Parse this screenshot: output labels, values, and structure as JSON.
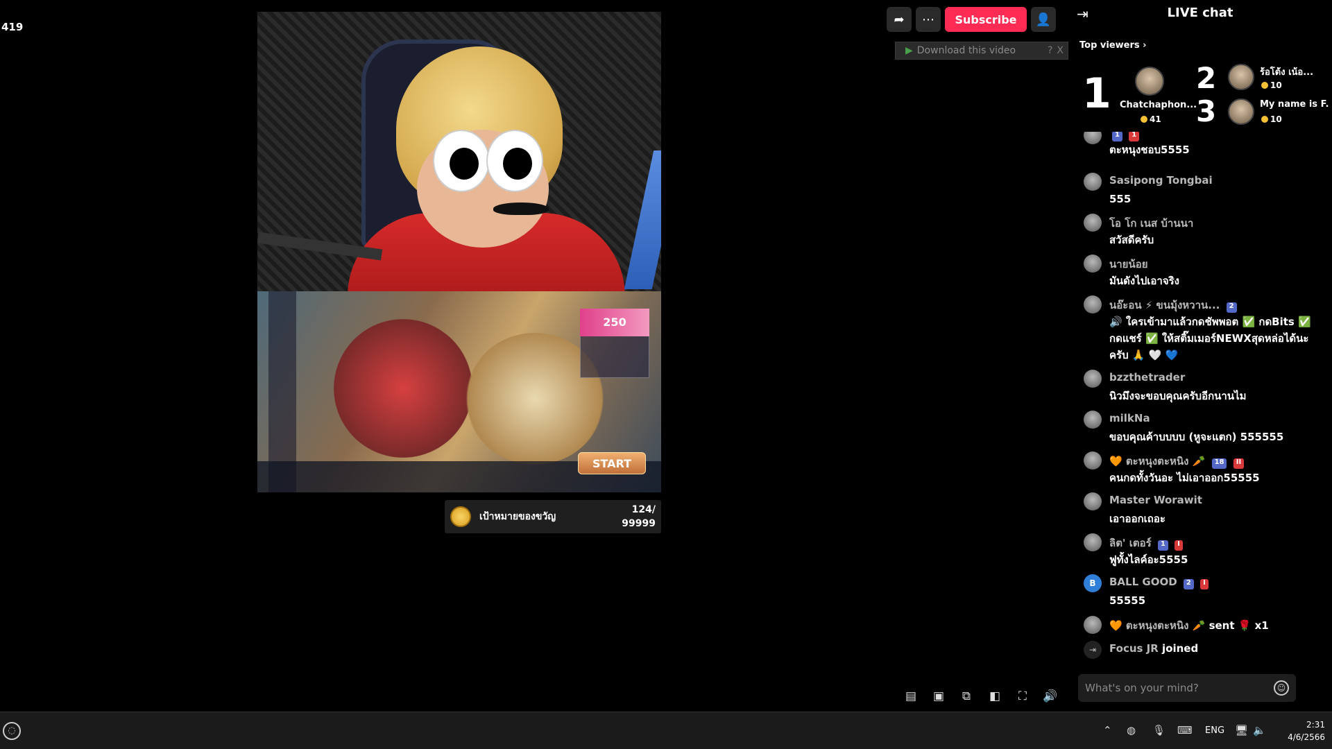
{
  "viewer_count": "419",
  "video": {
    "game_promo": "250",
    "game_start": "START",
    "goal": {
      "label": "เป้าหมายของขวัญ",
      "current": "124/",
      "target": "99999"
    }
  },
  "top_controls": {
    "share_icon": "share-icon",
    "more_icon": "more-icon",
    "subscribe_label": "Subscribe",
    "profile_icon": "user-icon",
    "download_label": "Download this video",
    "download_help": "?",
    "download_close": "X"
  },
  "video_controls": [
    "captions-icon",
    "picture-icon",
    "popout-icon",
    "mini-player-icon",
    "fullscreen-icon",
    "volume-icon"
  ],
  "chat": {
    "title": "LIVE chat",
    "top_viewers_label": "Top viewers",
    "top_viewers": [
      {
        "rank": "1",
        "name": "Chatchaphon...",
        "coins": "41"
      },
      {
        "rank": "2",
        "name": "ร้อโต้ง เน้อ...",
        "coins": "10"
      },
      {
        "rank": "3",
        "name": "My name is F...",
        "coins": "10"
      }
    ],
    "messages": [
      {
        "name": "",
        "text": "ตะหนุงชอบ5555",
        "badges": [
          "1",
          "1"
        ]
      },
      {
        "name": "Sasipong Tongbai",
        "text": "555",
        "badges": []
      },
      {
        "name": "โอ โก เนส บ้านนา",
        "text": "สวัสดีครับ",
        "badges": []
      },
      {
        "name": "นายน้อย",
        "text": "มันดังไปเอาจริง",
        "badges": []
      },
      {
        "name": "นอ๊ะอน ⚡ ขนมุ้งหวาน...",
        "text": "🔊 ใครเข้ามาแล้วกดชัพพอต ✅ กดBits ✅ กดแชร์ ✅ ให้สติ๊มเมอร์NEWXสุดหล่อได้นะครับ 🙏 🤍 💙",
        "badges": [
          "2"
        ]
      },
      {
        "name": "bzzthetrader",
        "text": "นิวมึงจะขอบคุณครับอีกนานไม",
        "badges": []
      },
      {
        "name": "milkNa",
        "text": "ขอบคุณค้าบบบบ (หูจะแตก) 555555",
        "badges": []
      },
      {
        "name": "🧡 ตะหนุงตะหนิง 🥕",
        "text": "คนกดทั้งวันอะ ไม่เอาออก55555",
        "badges": [
          "18",
          "II"
        ]
      },
      {
        "name": "Master Worawit",
        "text": "เอาออกเถอะ",
        "badges": []
      },
      {
        "name": "ลิต' เตอร์",
        "text": "ฟูทั้งไลค์อะ5555",
        "badges": [
          "1",
          "I"
        ]
      },
      {
        "name": "BALL GOOD",
        "text": "55555",
        "badges": [
          "2",
          "I"
        ]
      },
      {
        "name": "🧡 ตะหนุงตะหนิง 🥕",
        "text": "sent 🌹 x1",
        "badges": []
      },
      {
        "name": "Focus JR",
        "text": "joined",
        "badges": []
      }
    ],
    "input_placeholder": "What's on your mind?"
  },
  "taskbar": {
    "language": "ENG",
    "time": "2:31",
    "date": "4/6/2566"
  }
}
